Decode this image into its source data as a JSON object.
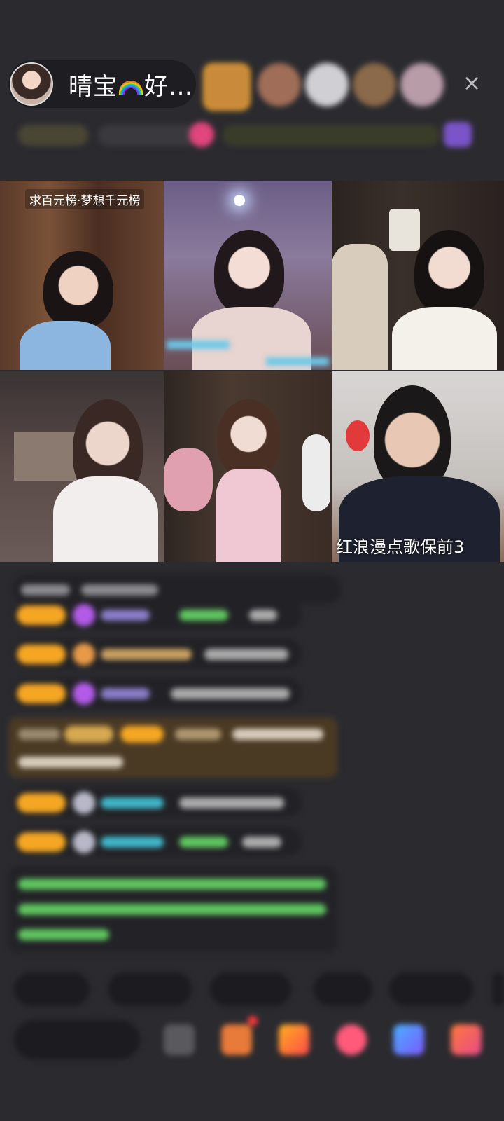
{
  "header": {
    "host_name_prefix": "晴宝",
    "host_name_suffix": "好…",
    "host_avatar_icon": "host-avatar",
    "close_icon": "×"
  },
  "video_grid": {
    "tiles": [
      {
        "label": "求百元榜·梦想千元榜"
      },
      {
        "label": ""
      },
      {
        "label": ""
      },
      {
        "label": ""
      },
      {
        "label": ""
      },
      {
        "label": "红浪漫点歌保前3"
      }
    ]
  },
  "colors": {
    "background": "#2b2b2f",
    "badge": "#f5a623",
    "highlight_msg": "#4a3a24",
    "green_text": "#5fc45f",
    "cyan_text": "#3fb6c9",
    "purple_gem": "#b25be8"
  }
}
